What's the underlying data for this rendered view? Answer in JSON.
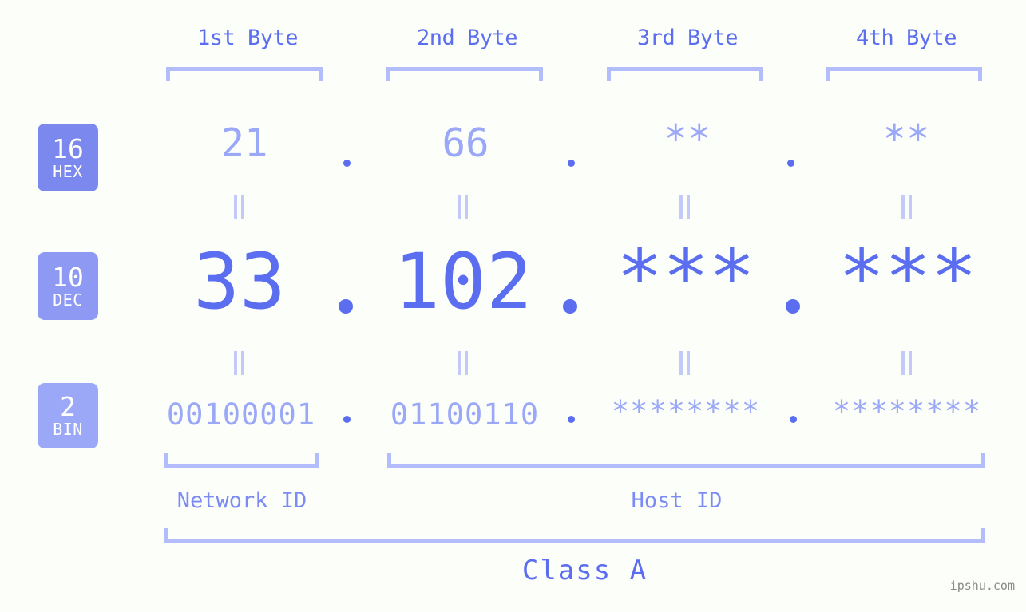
{
  "meta": {
    "watermark": "ipshu.com",
    "background_color": "#fcfefa",
    "accent_color": "#5b6ef0",
    "accent_light_color": "#9aa8f7",
    "bracket_color": "#b4bdfb"
  },
  "byte_headers": [
    {
      "label": "1st Byte"
    },
    {
      "label": "2nd Byte"
    },
    {
      "label": "3rd Byte"
    },
    {
      "label": "4th Byte"
    }
  ],
  "bases": [
    {
      "number": "16",
      "name": "HEX",
      "badge_color": "#7b89ee"
    },
    {
      "number": "10",
      "name": "DEC",
      "badge_color": "#8d99f2"
    },
    {
      "number": "2",
      "name": "BIN",
      "badge_color": "#9aa8f7"
    }
  ],
  "rows": {
    "hex": {
      "base": "16",
      "base_name": "HEX",
      "values": [
        "21",
        "66",
        "**",
        "**"
      ]
    },
    "dec": {
      "base": "10",
      "base_name": "DEC",
      "values": [
        "33",
        "102",
        "***",
        "***"
      ]
    },
    "bin": {
      "base": "2",
      "base_name": "BIN",
      "values": [
        "00100001",
        "01100110",
        "********",
        "********"
      ]
    }
  },
  "separators": {
    "symbol": "."
  },
  "equals": {
    "symbol": "="
  },
  "sections": [
    {
      "label": "Network ID"
    },
    {
      "label": "Host ID"
    }
  ],
  "class": {
    "label": "Class A"
  }
}
